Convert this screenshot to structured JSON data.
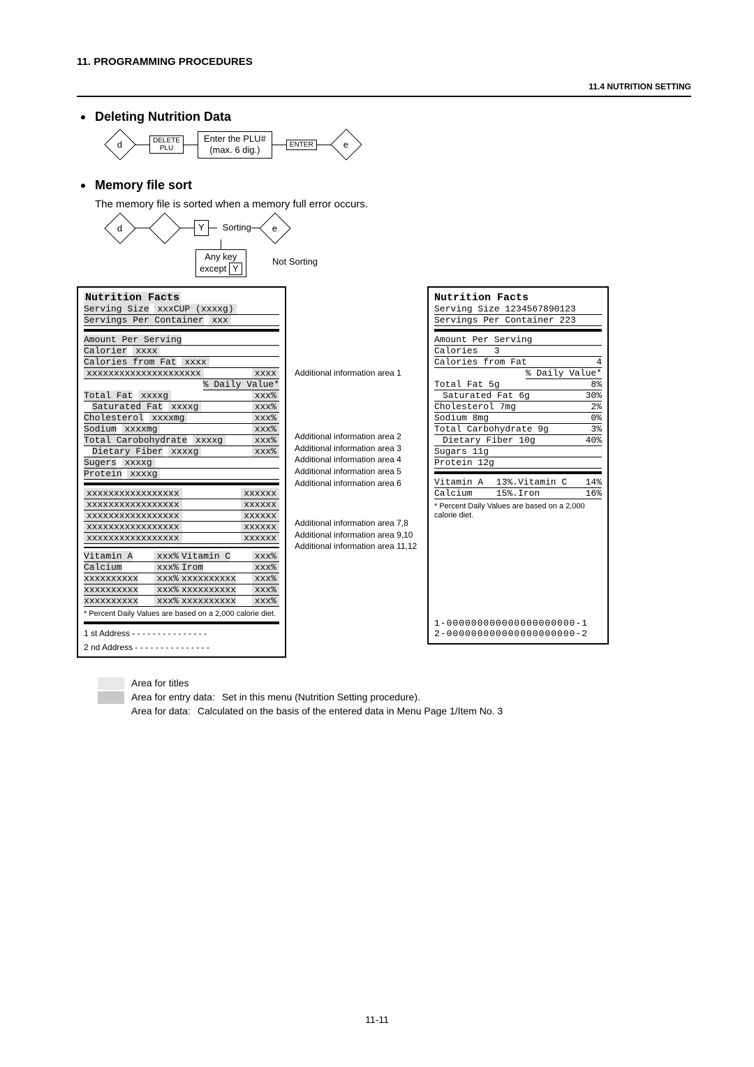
{
  "header": {
    "chapter": "11.  PROGRAMMING PROCEDURES",
    "section": "11.4 NUTRITION SETTING"
  },
  "sec1": {
    "title": "Deleting Nutrition Data",
    "flow": {
      "d": "d",
      "delplu_l1": "DELETE",
      "delplu_l2": "PLU",
      "enterPlu_l1": "Enter the PLU#",
      "enterPlu_l2": "(max. 6 dig.)",
      "enter": "ENTER",
      "e": "e"
    }
  },
  "sec2": {
    "title": "Memory file sort",
    "desc": "The memory file is sorted when a memory full error occurs.",
    "flow": {
      "d": "d",
      "diamond": "",
      "Y": "Y",
      "sorting": "Sorting",
      "e": "e",
      "anykey_l1": "Any key",
      "anykey_l2": "except",
      "anykey_y": "Y",
      "notsort": "Not Sorting"
    }
  },
  "left": {
    "title": "Nutrition Facts",
    "serving": "Serving Size",
    "serving_v": "xxxCUP (xxxxg)",
    "servings_per": "Servings Per Container",
    "servings_per_v": "xxx",
    "amount_per": "Amount Per Serving",
    "calories": "Calorier",
    "calories_v": "xxxx",
    "calfat": "Calories from Fat",
    "calfat_v": "xxxx",
    "addinfo1_l": "xxxxxxxxxxxxxxxxxxxxx",
    "addinfo1_v": "xxxx",
    "dv_label": "% Daily Value*",
    "rows": [
      {
        "name": "Total Fat",
        "val": "xxxxg",
        "pct": "xxx%"
      },
      {
        "name": "Saturated Fat",
        "val": "xxxxg",
        "pct": "xxx%",
        "indent": true
      },
      {
        "name": "Cholesterol",
        "val": "xxxxmg",
        "pct": "xxx%"
      },
      {
        "name": "Sodium",
        "val": "xxxxmg",
        "pct": "xxx%"
      },
      {
        "name": "Total Carobohydrate",
        "val": "xxxxg",
        "pct": "xxx%"
      },
      {
        "name": "Dietary Fiber",
        "val": "xxxxg",
        "pct": "xxx%",
        "indent": true
      },
      {
        "name": "Sugers",
        "val": "xxxxg",
        "pct": ""
      },
      {
        "name": "Protein",
        "val": "xxxxg",
        "pct": ""
      }
    ],
    "addrows": [
      {
        "l": "xxxxxxxxxxxxxxxxx",
        "r": "xxxxxx"
      },
      {
        "l": "xxxxxxxxxxxxxxxxx",
        "r": "xxxxxx"
      },
      {
        "l": "xxxxxxxxxxxxxxxxx",
        "r": "xxxxxx"
      },
      {
        "l": "xxxxxxxxxxxxxxxxx",
        "r": "xxxxxx"
      },
      {
        "l": "xxxxxxxxxxxxxxxxx",
        "r": "xxxxxx"
      }
    ],
    "vit": [
      {
        "a": "Vitamin A",
        "av": "xxx%",
        "b": "Vitamin C",
        "bv": "xxx%"
      },
      {
        "a": "Calcium",
        "av": "xxx%",
        "b": "Irom",
        "bv": "xxx%"
      },
      {
        "a": "xxxxxxxxxx",
        "av": "xxx%",
        "b": "xxxxxxxxxx",
        "bv": "xxx%"
      },
      {
        "a": "xxxxxxxxxx",
        "av": "xxx%",
        "b": "xxxxxxxxxx",
        "bv": "xxx%"
      },
      {
        "a": "xxxxxxxxxx",
        "av": "xxx%",
        "b": "xxxxxxxxxx",
        "bv": "xxx%"
      }
    ],
    "note": "*   Percent Daily Values are based on a 2,000 calorie diet.",
    "addr1": "1 st   Address - - - - - - - - - - - - - - -",
    "addr2": "2 nd  Address - - - - - - - - - - - - - - -"
  },
  "mid": {
    "a1": "Additional information area 1",
    "a2": "Additional information area 2",
    "a3": "Additional information area 3",
    "a4": "Additional information area 4",
    "a5": "Additional information area 5",
    "a6": "Additional information area 6",
    "a78": "Additional information area 7,8",
    "a910": "Additional information area 9,10",
    "a1112": "Additional information area 11,12"
  },
  "right": {
    "title": "Nutrition Facts",
    "serving": "Serving Size 1234567890123",
    "servings_per": "Servings Per Container 223",
    "amount_per": "Amount Per Serving",
    "calories": "Calories",
    "calories_v": "3",
    "calfat": "Calories from Fat",
    "calfat_v": "4",
    "dv_label": "% Daily Value*",
    "rows": [
      {
        "name": "Total Fat",
        "val": "5g",
        "pct": "8%"
      },
      {
        "name": "Saturated Fat",
        "val": "6g",
        "pct": "30%",
        "indent": true
      },
      {
        "name": "Cholesterol",
        "val": "7mg",
        "pct": "2%"
      },
      {
        "name": "Sodium",
        "val": "8mg",
        "pct": "0%"
      },
      {
        "name": "Total Carbohydrate",
        "val": "9g",
        "pct": "3%"
      },
      {
        "name": "Dietary Fiber",
        "val": "10g",
        "pct": "40%",
        "indent": true
      },
      {
        "name": "Sugars",
        "val": "11g",
        "pct": ""
      },
      {
        "name": "Protein",
        "val": "12g",
        "pct": ""
      }
    ],
    "vit": [
      {
        "a": "Vitamin A",
        "av": "13%.",
        "b": "Vitamin C",
        "bv": "14%"
      },
      {
        "a": "Calcium",
        "av": "15%.",
        "b": "Iron",
        "bv": "16%"
      }
    ],
    "note": "*   Percent Daily Values are based on a 2,000 calorie diet.",
    "lnum1": "1-000000000000000000000-1",
    "lnum2": "2-000000000000000000000-2"
  },
  "legend": {
    "r1": "Area for titles",
    "r2a": "Area for entry data:",
    "r2b": "Set in this menu (Nutrition Setting procedure).",
    "r3a": "Area for data:",
    "r3b": "Calculated on the basis of the entered data in Menu Page 1/Item No. 3"
  },
  "pagenum": "11-11"
}
